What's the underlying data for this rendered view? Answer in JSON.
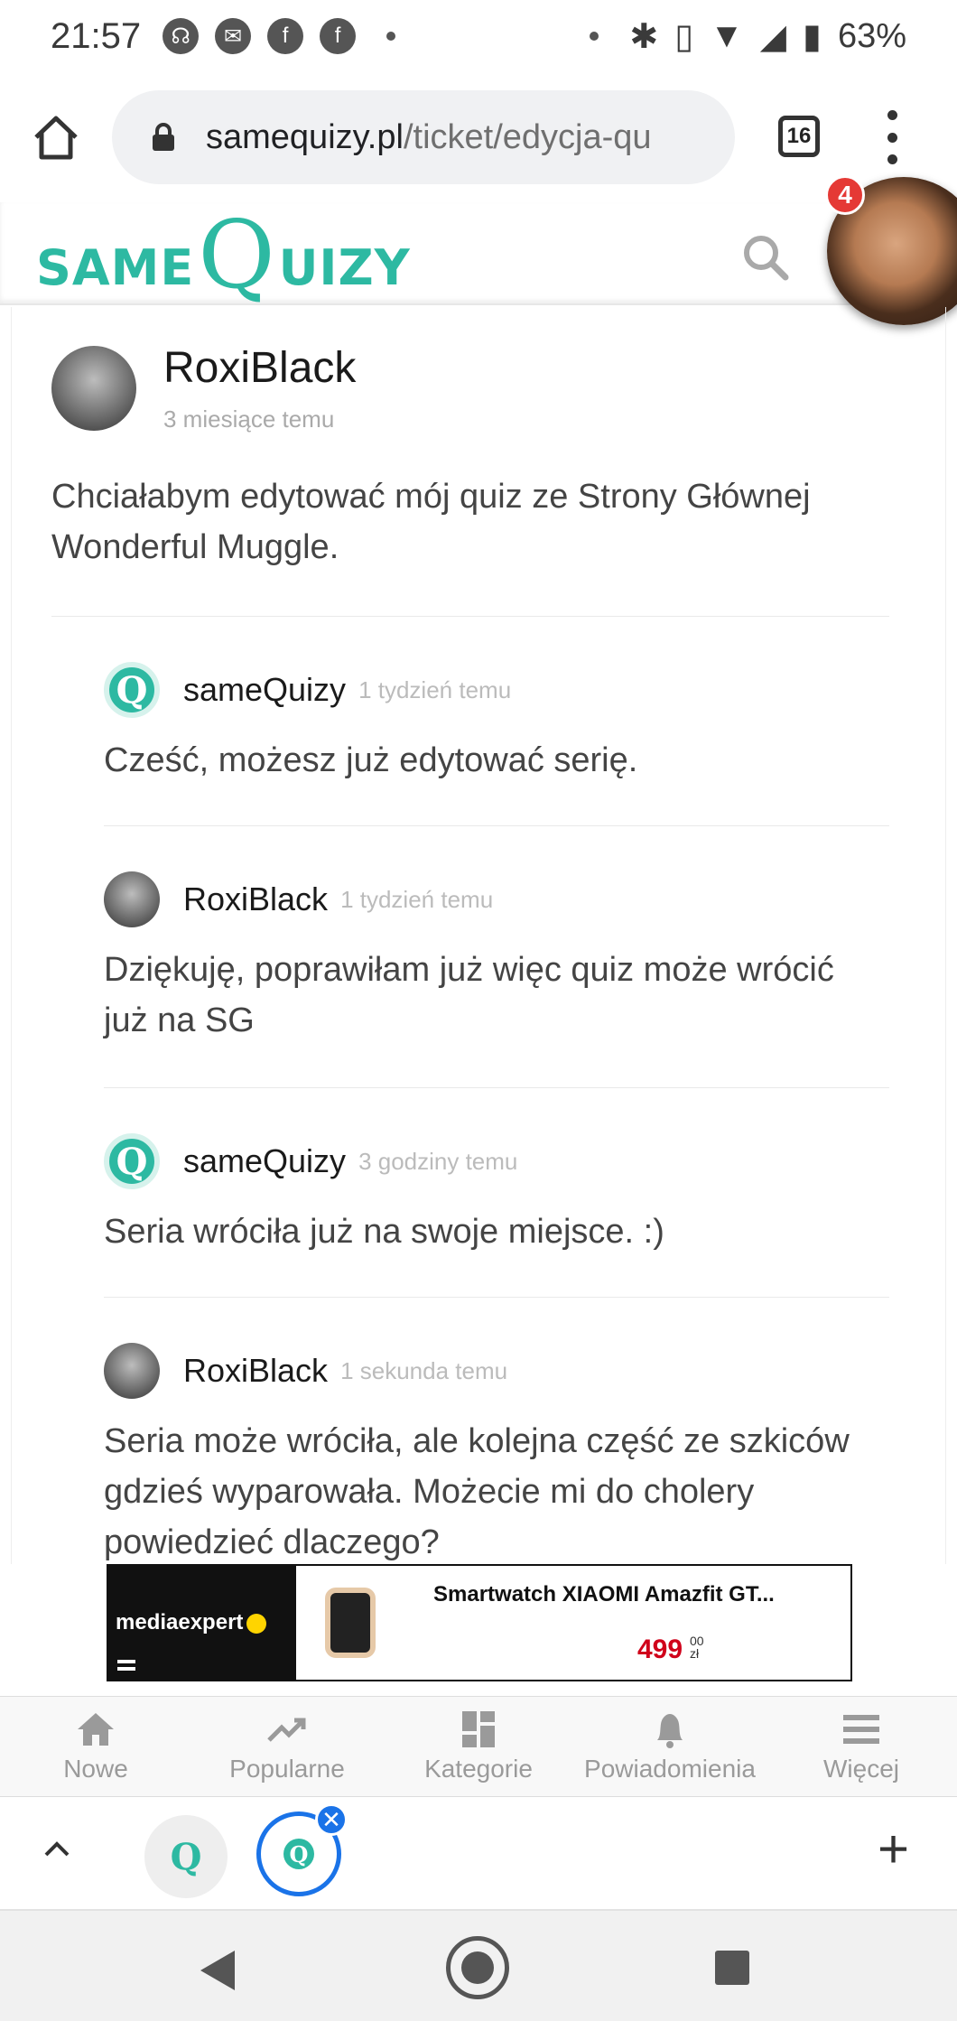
{
  "status_bar": {
    "time": "21:57",
    "battery": "63%"
  },
  "browser": {
    "url_domain": "samequizy.pl",
    "url_path": "/ticket/edycja-qu",
    "tab_count": "16"
  },
  "site": {
    "logo": {
      "part1": "SAME",
      "part2": "Q",
      "part3": "UIZY"
    },
    "notification_count": "4"
  },
  "post": {
    "author": "RoxiBlack",
    "time": "3 miesiące temu",
    "text": "Chciałabym edytować mój quiz ze Strony Głównej Wonderful Muggle."
  },
  "replies": [
    {
      "author": "sameQuizy",
      "time": "1 tydzień temu",
      "text": "Cześć, możesz już edytować serię.",
      "avatar": "q"
    },
    {
      "author": "RoxiBlack",
      "time": "1 tydzień temu",
      "text": "Dziękuję, poprawiłam już więc quiz może wrócić już na SG",
      "avatar": "user"
    },
    {
      "author": "sameQuizy",
      "time": "3 godziny temu",
      "text": "Seria wróciła już na swoje miejsce. :)",
      "avatar": "q"
    },
    {
      "author": "RoxiBlack",
      "time": "1 sekunda temu",
      "text": "Seria może wróciła, ale kolejna część ze szkiców gdzieś wyparowała. Możecie mi do cholery powiedzieć dlaczego?",
      "avatar": "user"
    }
  ],
  "ad": {
    "brand": "mediaexpert",
    "product": "Smartwatch XIAOMI Amazfit GT...",
    "price": "499",
    "price_cents": "00",
    "currency": "zł"
  },
  "site_nav": [
    {
      "label": "Nowe",
      "icon": "home-icon"
    },
    {
      "label": "Popularne",
      "icon": "trending-icon"
    },
    {
      "label": "Kategorie",
      "icon": "grid-icon"
    },
    {
      "label": "Powiadomienia",
      "icon": "bell-icon"
    },
    {
      "label": "Więcej",
      "icon": "hamburger-icon"
    }
  ],
  "colors": {
    "brand": "#2db9a2",
    "accent_blue": "#1a73e8",
    "badge": "#e53935",
    "price": "#d0021b"
  }
}
